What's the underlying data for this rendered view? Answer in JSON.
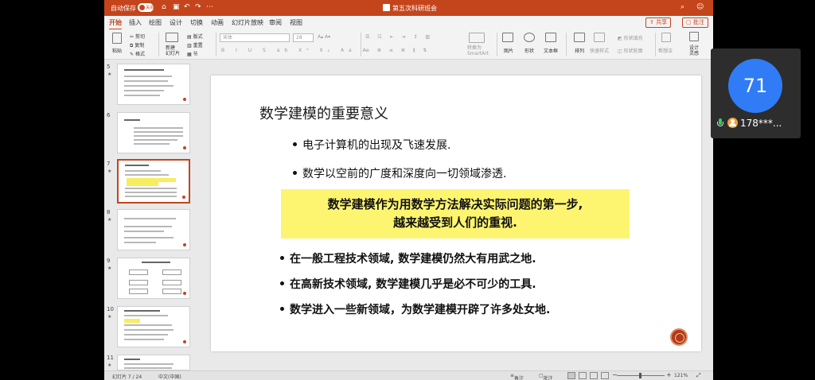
{
  "titlebar": {
    "autosave_label": "自动保存",
    "autosave_state": "关闭",
    "doc_title": "第五次科研班会"
  },
  "tabs": [
    "开始",
    "插入",
    "绘图",
    "设计",
    "切换",
    "动画",
    "幻灯片放映",
    "审阅",
    "视图"
  ],
  "share_label": "共享",
  "comment_label": "批注",
  "ribbon": {
    "paste": "粘贴",
    "cut": "剪切",
    "copy": "复制",
    "format": "格式",
    "new_slide": "新建\n幻灯片",
    "layout": "版式",
    "reset": "重置",
    "section": "节",
    "font_placeholder": "宋体",
    "size_placeholder": "28",
    "smartart": "转换为\nSmartArt",
    "picture": "图片",
    "shape": "形状",
    "textbox": "文本框",
    "arrange": "排列",
    "quick_styles": "快速样式",
    "shape_fill": "形状填充",
    "shape_outline": "形状轮廓",
    "designer": "帮想法",
    "design_ideas": "设计\n灵感"
  },
  "thumbnails": [
    {
      "num": "5"
    },
    {
      "num": "6"
    },
    {
      "num": "7"
    },
    {
      "num": "8"
    },
    {
      "num": "9"
    },
    {
      "num": "10"
    },
    {
      "num": "11"
    }
  ],
  "slide": {
    "title": "数学建模的重要意义",
    "bullets_top": [
      "电子计算机的出现及飞速发展.",
      "数学以空前的广度和深度向一切领域渗透."
    ],
    "highlight_line1": "数学建模作为用数学方法解决实际问题的第一步,",
    "highlight_line2": "越来越受到人们的重视.",
    "bullets_bottom": [
      "在一般工程技术领域, 数学建模仍然大有用武之地.",
      "在高新技术领域, 数学建模几乎是必不可少的工具.",
      "数学进入一些新领域，为数学建模开辟了许多处女地."
    ]
  },
  "status": {
    "slide_counter": "幻灯片 7 / 24",
    "language": "中文(中国)",
    "notes": "备注",
    "comments": "批注",
    "zoom": "121%"
  },
  "meeting": {
    "avatar_text": "71",
    "user_name": "178***..."
  },
  "colors": {
    "accent": "#c4451c",
    "highlight": "#fdf570",
    "avatar": "#2f7cf6"
  }
}
